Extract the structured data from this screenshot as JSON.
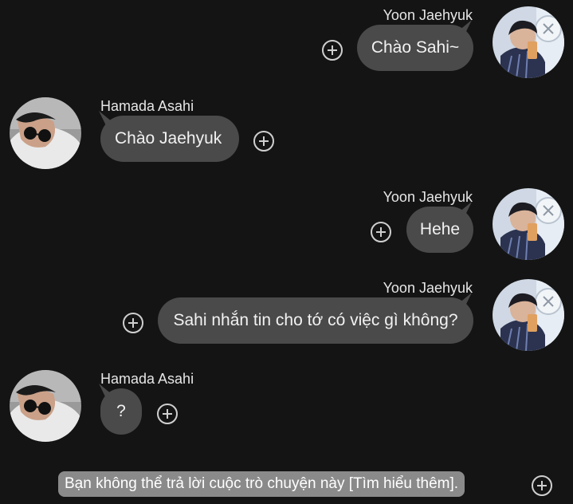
{
  "messages": [
    {
      "sender": "Yoon Jaehyuk",
      "text": "Chào Sahi~",
      "side": "right"
    },
    {
      "sender": "Hamada Asahi",
      "text": "Chào Jaehyuk",
      "side": "left"
    },
    {
      "sender": "Yoon Jaehyuk",
      "text": "Hehe",
      "side": "right"
    },
    {
      "sender": "Yoon Jaehyuk",
      "text": "Sahi nhắn tin cho tớ có việc gì không?",
      "side": "right"
    },
    {
      "sender": "Hamada Asahi",
      "text": "?",
      "side": "left"
    }
  ],
  "footer": {
    "notice": "Bạn không thể trả lời cuộc trò chuyện này [Tìm hiểu thêm]."
  },
  "colors": {
    "background": "#141414",
    "bubble": "#4a4a4a",
    "notice": "#8a8a8a"
  },
  "icons": {
    "add": "plus-circle-icon",
    "avatar": "user-avatar"
  }
}
